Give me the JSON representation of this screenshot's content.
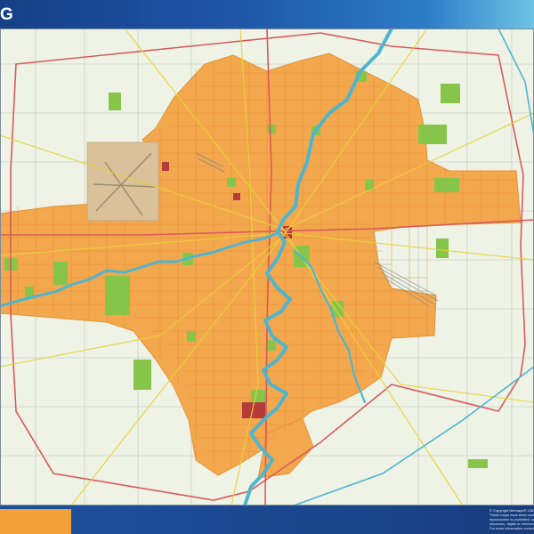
{
  "title": "G",
  "copyright_lines": [
    "© Copyright Netmaps® 1987-2...",
    "These maps have been created...",
    "reproduction is prohibited, so...",
    "electronic, digital or mechanic...",
    "For more information consult w..."
  ],
  "colors": {
    "background": "#eef3e6",
    "urban": "#f4a84d",
    "urban_dark": "#e78a2d",
    "park": "#86c44a",
    "water": "#4fb5cf",
    "highway": "#d95a5a",
    "main_road": "#e8d23a",
    "minor_road": "#8a8f98",
    "airport": "#d8c19b",
    "industrial": "#b53a3a",
    "header_start": "#163f86",
    "header_end": "#6fc3e4",
    "footer_accent": "#f2a13a"
  }
}
